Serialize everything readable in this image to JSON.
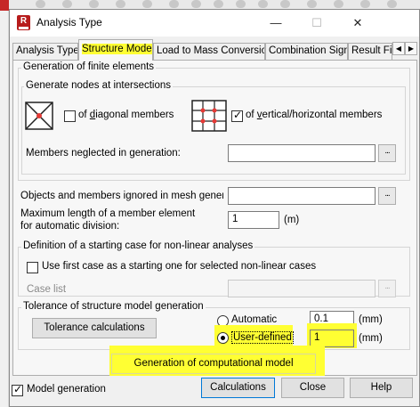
{
  "dialog": {
    "title": "Analysis Type",
    "controls": {
      "minimize": "—",
      "maximize": "☐",
      "close": "✕"
    },
    "app_icon_letter": "R"
  },
  "tabs": [
    {
      "label": "Analysis Types"
    },
    {
      "label": "Structure Model",
      "active": true
    },
    {
      "label": "Load to Mass Conversion"
    },
    {
      "label": "Combination Sign"
    },
    {
      "label": "Result Fi"
    }
  ],
  "tab_scroll": {
    "left": "◀",
    "right": "▶"
  },
  "generation": {
    "group_label": "Generation of finite elements",
    "nodes_group_label": "Generate nodes at intersections",
    "diagonal_checkbox": {
      "prefix": "of ",
      "underlined": "d",
      "rest": "iagonal members",
      "checked": false
    },
    "vh_checkbox": {
      "prefix": "of ",
      "underlined": "v",
      "rest": "ertical/horizontal members",
      "checked": true
    },
    "members_neglected_label": "Members neglected in generation:",
    "members_neglected_value": "",
    "browse_label": "..."
  },
  "objects_ignored_label": "Objects and members ignored in mesh generatio",
  "objects_ignored_value": "",
  "max_length": {
    "label_line1": "Maximum length of a member element",
    "label_line2": "for automatic division:",
    "value": "1",
    "unit": "(m)"
  },
  "nonlinear": {
    "group_label": "Definition of a starting case for non-linear analyses",
    "checkbox_label": "Use first case as a starting one for selected non-linear cases",
    "checked": false,
    "case_list_label": "Case list",
    "case_list_value": ""
  },
  "tolerance": {
    "group_label": "Tolerance of structure model generation",
    "calc_button": "Tolerance calculations",
    "automatic_label": "Automatic",
    "automatic_value": "0.1",
    "user_defined_label": "User-defined",
    "user_defined_value": "1",
    "unit": "(mm)",
    "selected": "User-defined"
  },
  "generate_button": "Generation of computational model",
  "footer": {
    "model_generation_label": "Model generation",
    "model_generation_checked": true,
    "calculations": "Calculations",
    "close": "Close",
    "help": "Help"
  },
  "colors": {
    "highlight": "#ffff33",
    "accent": "#0078d7",
    "app_icon": "#b71c1c"
  }
}
